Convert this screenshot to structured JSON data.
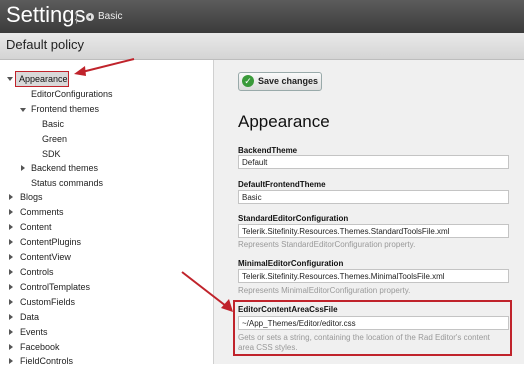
{
  "header": {
    "title": "Settings",
    "separator": "|",
    "breadcrumb": "Basic"
  },
  "subheader": {
    "title": "Default policy"
  },
  "sidebar": {
    "selected": "Appearance",
    "editor_configurations": "EditorConfigurations",
    "frontend_themes": "Frontend themes",
    "themes": [
      "Basic",
      "Green",
      "SDK"
    ],
    "backend_themes": "Backend themes",
    "status_commands": "Status commands",
    "items": [
      "Blogs",
      "Comments",
      "Content",
      "ContentPlugins",
      "ContentView",
      "Controls",
      "ControlTemplates",
      "CustomFields",
      "Data",
      "Events",
      "Facebook",
      "FieldControls"
    ]
  },
  "main": {
    "save_label": "Save changes",
    "section_title": "Appearance",
    "fields": [
      {
        "label": "BackendTheme",
        "value": "Default",
        "description": ""
      },
      {
        "label": "DefaultFrontendTheme",
        "value": "Basic",
        "description": ""
      },
      {
        "label": "StandardEditorConfiguration",
        "value": "Telerik.Sitefinity.Resources.Themes.StandardToolsFile.xml",
        "description": "Represents StandardEditorConfiguration property."
      },
      {
        "label": "MinimalEditorConfiguration",
        "value": "Telerik.Sitefinity.Resources.Themes.MinimalToolsFile.xml",
        "description": "Represents MinimalEditorConfiguration property."
      },
      {
        "label": "EditorContentAreaCssFile",
        "value": "~/App_Themes/Editor/editor.css",
        "description": "Gets or sets a string, containing the location of the Rad Editor's content area CSS styles."
      }
    ]
  },
  "colors": {
    "annotation": "#c0232b",
    "save_icon": "#3a9a3a"
  },
  "icons": [
    "breadcrumb-back-icon",
    "save-check-icon",
    "expand-icon",
    "collapse-icon",
    "annotation-arrow-icon"
  ]
}
